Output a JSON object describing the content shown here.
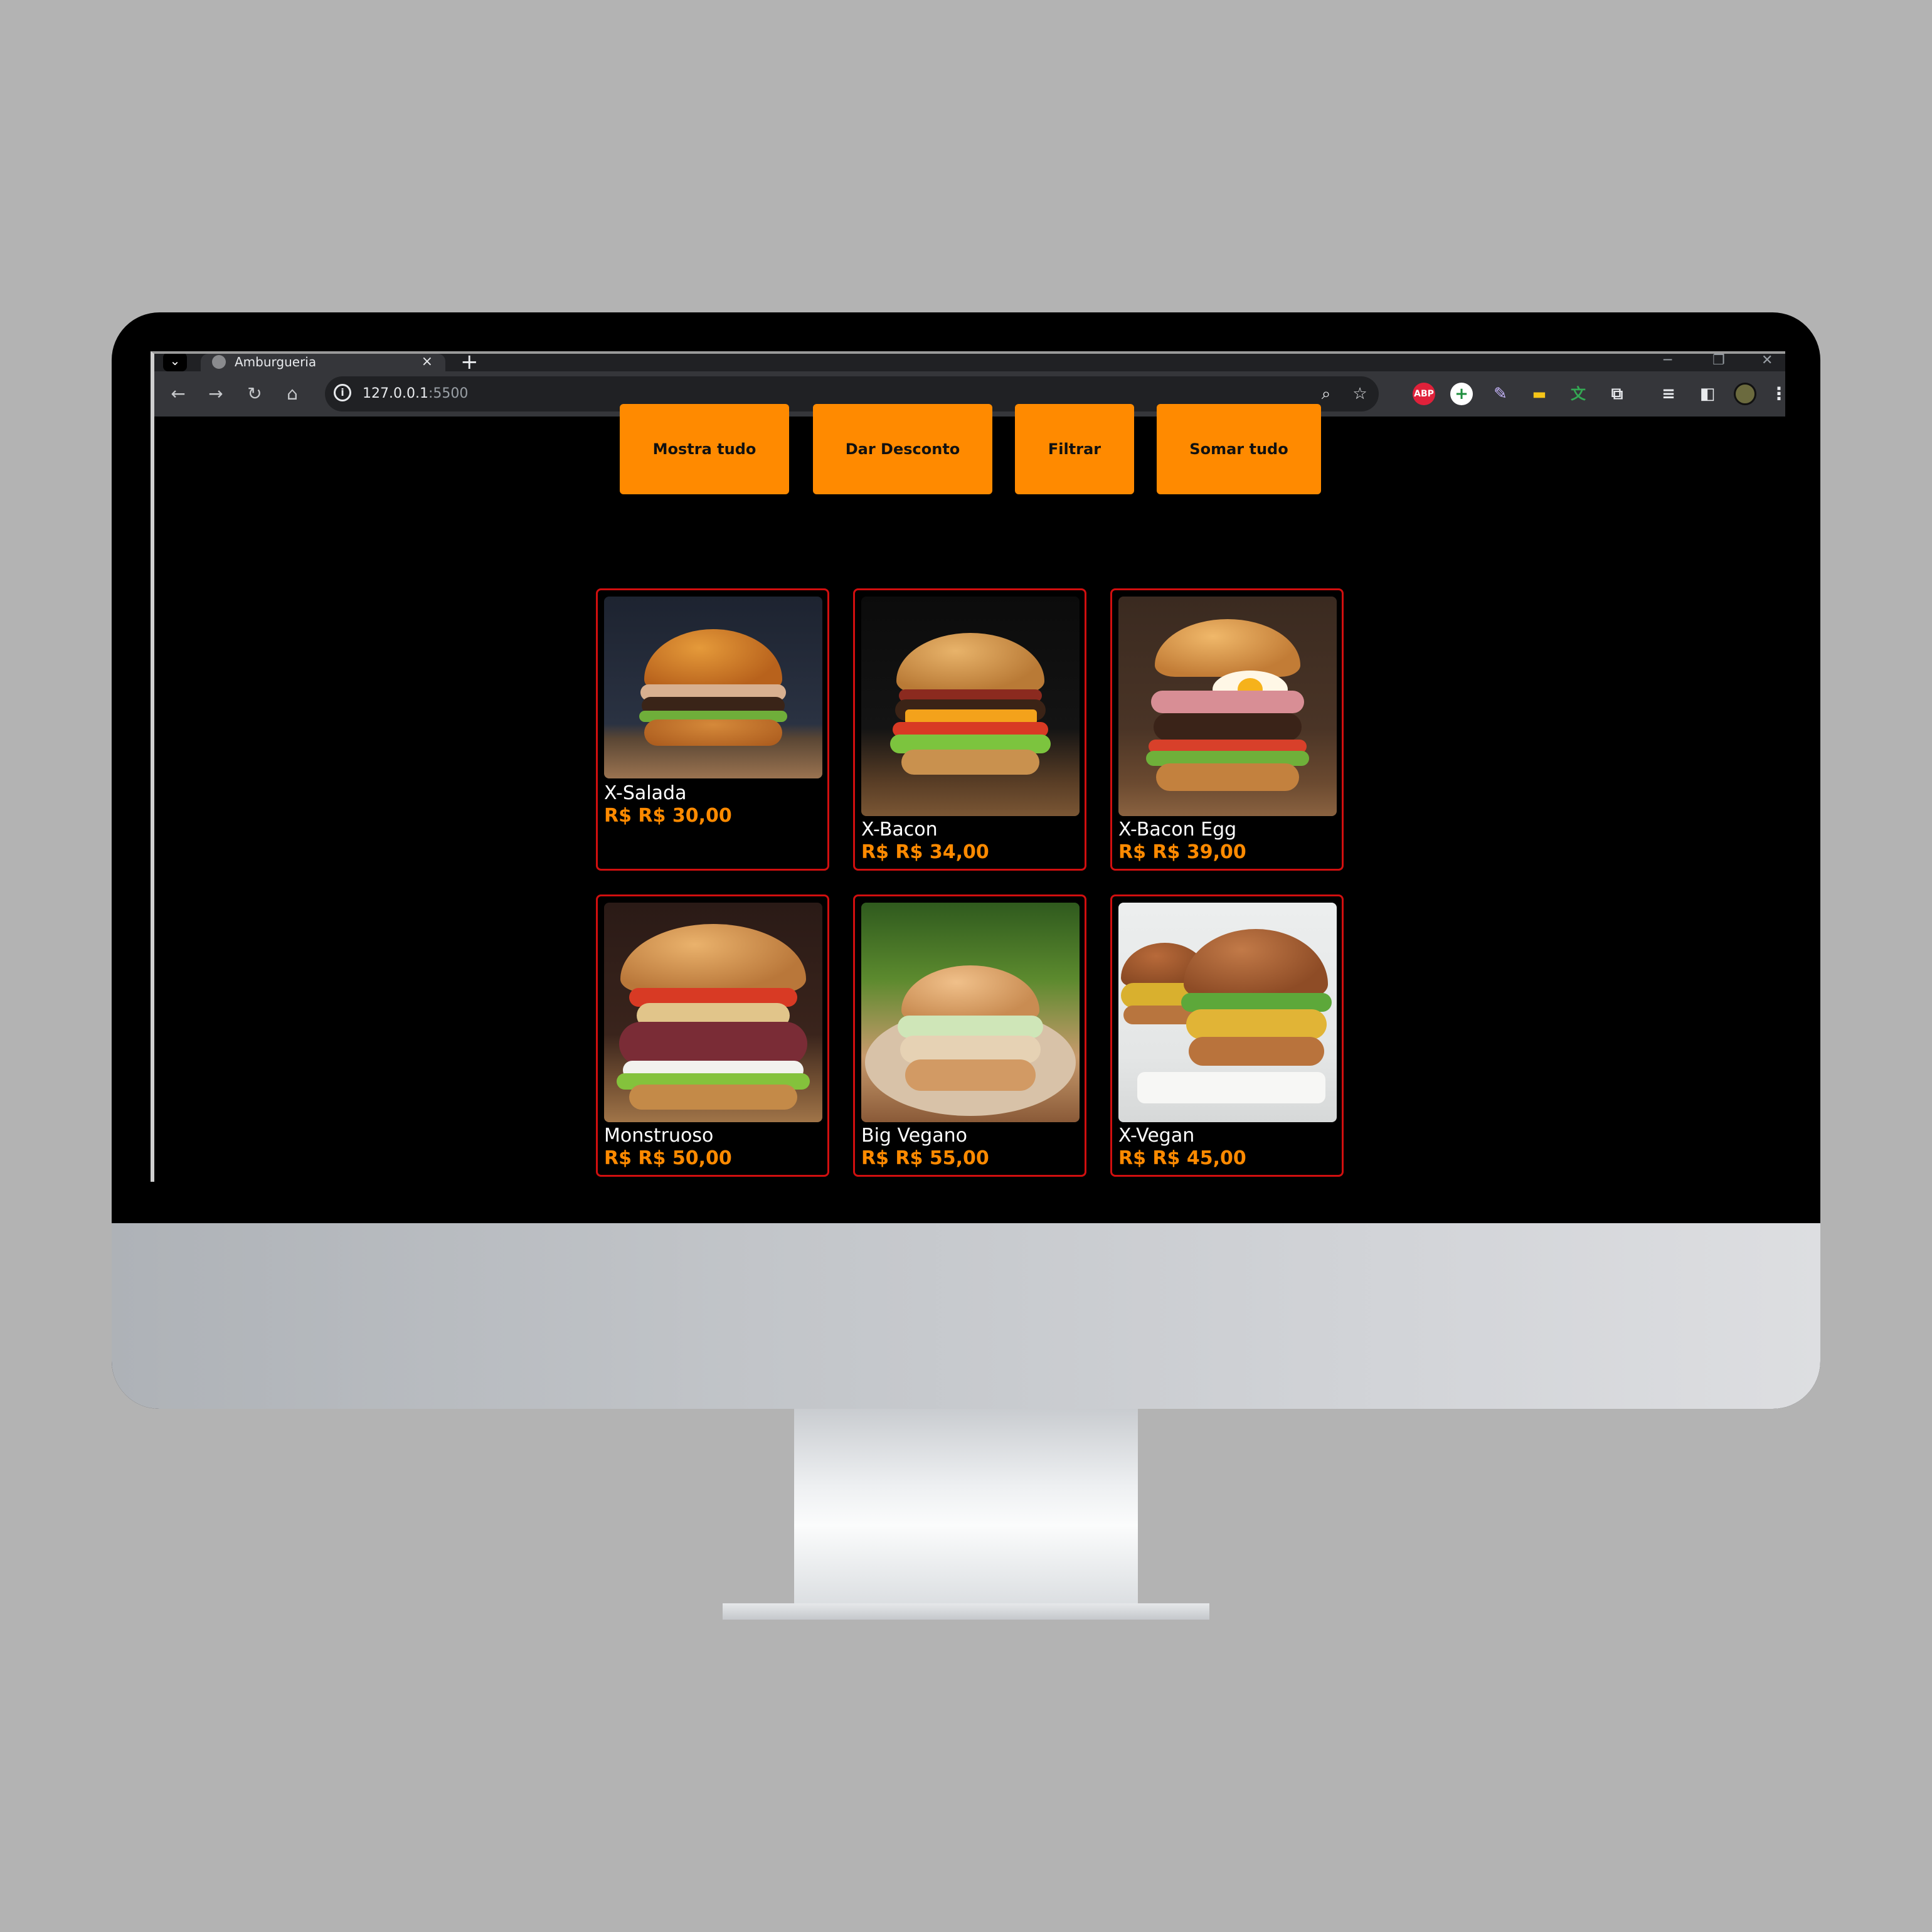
{
  "browser": {
    "tab_title": "Amburgueria",
    "new_tab": "+",
    "close_tab": "×",
    "url_host": "127.0.0.1",
    "url_port": ":5500",
    "ext_abp": "ABP"
  },
  "actions": [
    {
      "label": "Mostra tudo"
    },
    {
      "label": "Dar Desconto"
    },
    {
      "label": "Filtrar"
    },
    {
      "label": "Somar tudo"
    }
  ],
  "products": [
    {
      "name": "X-Salada",
      "price": "R$ R$ 30,00"
    },
    {
      "name": "X-Bacon",
      "price": "R$ R$ 34,00"
    },
    {
      "name": "X-Bacon Egg",
      "price": "R$ R$ 39,00"
    },
    {
      "name": "Monstruoso",
      "price": "R$ R$ 50,00"
    },
    {
      "name": "Big Vegano",
      "price": "R$ R$ 55,00"
    },
    {
      "name": "X-Vegan",
      "price": "R$ R$ 45,00"
    }
  ],
  "colors": {
    "accent": "#ff8a00",
    "card_border": "#d10f0f",
    "page_bg": "#000000"
  }
}
